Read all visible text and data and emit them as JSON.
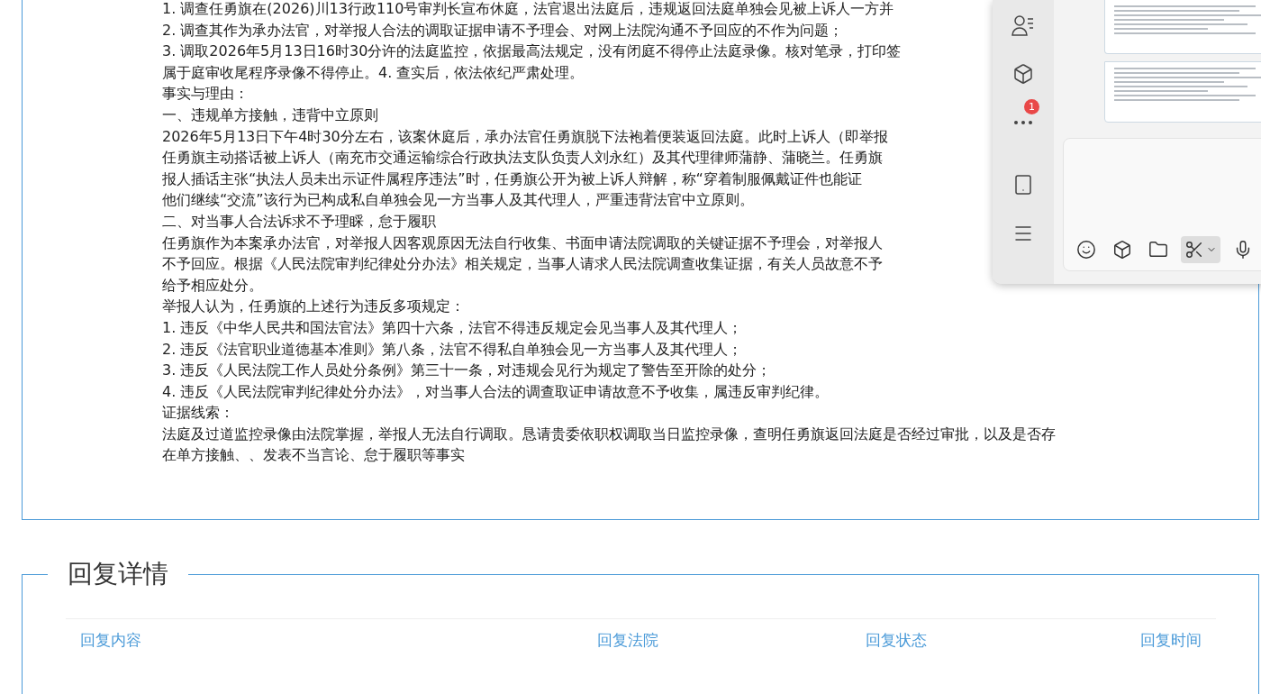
{
  "complaint": {
    "lines": [
      "1. 调查任勇旗在(2026)川13行政110号审判长宣布休庭，法官退出法庭后，违规返回法庭单独会见被上诉人一方并",
      "2. 调查其作为承办法官，对举报人合法的调取证据申请不予理会、对网上法院沟通不予回应的不作为问题；",
      "3. 调取2026年5月13日16时30分许的法庭监控，依据最高法规定，没有闭庭不得停止法庭录像。核对笔录，打印签",
      "属于庭审收尾程序录像不得停止。4. 查实后，依法依纪严肃处理。",
      "事实与理由：",
      "一、违规单方接触，违背中立原则",
      "2026年5月13日下午4时30分左右，该案休庭后，承办法官任勇旗脱下法袍着便装返回法庭。此时上诉人（即举报",
      "任勇旗主动搭话被上诉人（南充市交通运输综合行政执法支队负责人刘永红）及其代理律师蒲静、蒲晓兰。任勇旗",
      "报人插话主张“执法人员未出示证件属程序违法”时，任勇旗公开为被上诉人辩解，称“穿着制服佩戴证件也能证",
      "他们继续“交流”该行为已构成私自单独会见一方当事人及其代理人，严重违背法官中立原则。",
      "二、对当事人合法诉求不予理睬，怠于履职",
      "任勇旗作为本案承办法官，对举报人因客观原因无法自行收集、书面申请法院调取的关键证据不予理会，对举报人",
      "不予回应。根据《人民法院审判纪律处分办法》相关规定，当事人请求人民法院调查收集证据，有关人员故意不予",
      "给予相应处分。",
      "举报人认为，任勇旗的上述行为违反多项规定：",
      "1. 违反《中华人民共和国法官法》第四十六条，法官不得违反规定会见当事人及其代理人；",
      "2. 违反《法官职业道德基本准则》第八条，法官不得私自单独会见一方当事人及其代理人；",
      "3. 违反《人民法院工作人员处分条例》第三十一条，对违规会见行为规定了警告至开除的处分；",
      "4. 违反《人民法院审判纪律处分办法》，对当事人合法的调查取证申请故意不予收集，属违反审判纪律。",
      "证据线索：",
      "法庭及过道监控录像由法院掌握，举报人无法自行调取。恳请贵委依职权调取当日监控录像，查明任勇旗返回法庭是否经过审批，以及是否存",
      "在单方接触、、发表不当言论、怠于履职等事实"
    ]
  },
  "reply_details": {
    "title": "回复详情",
    "columns": [
      "回复内容",
      "回复法院",
      "回复状态",
      "回复时间"
    ]
  },
  "chat_window": {
    "sidebar": [
      {
        "kind": "contacts"
      },
      {
        "kind": "cube"
      },
      {
        "kind": "more",
        "badge": "1"
      },
      {
        "kind": "spacer"
      },
      {
        "kind": "phone"
      },
      {
        "kind": "menu"
      }
    ],
    "toolbar": [
      {
        "kind": "emoji",
        "selected": false
      },
      {
        "kind": "cube",
        "selected": false
      },
      {
        "kind": "folder",
        "selected": false
      },
      {
        "kind": "scissors",
        "selected": true
      },
      {
        "kind": "mic",
        "selected": false
      }
    ]
  }
}
